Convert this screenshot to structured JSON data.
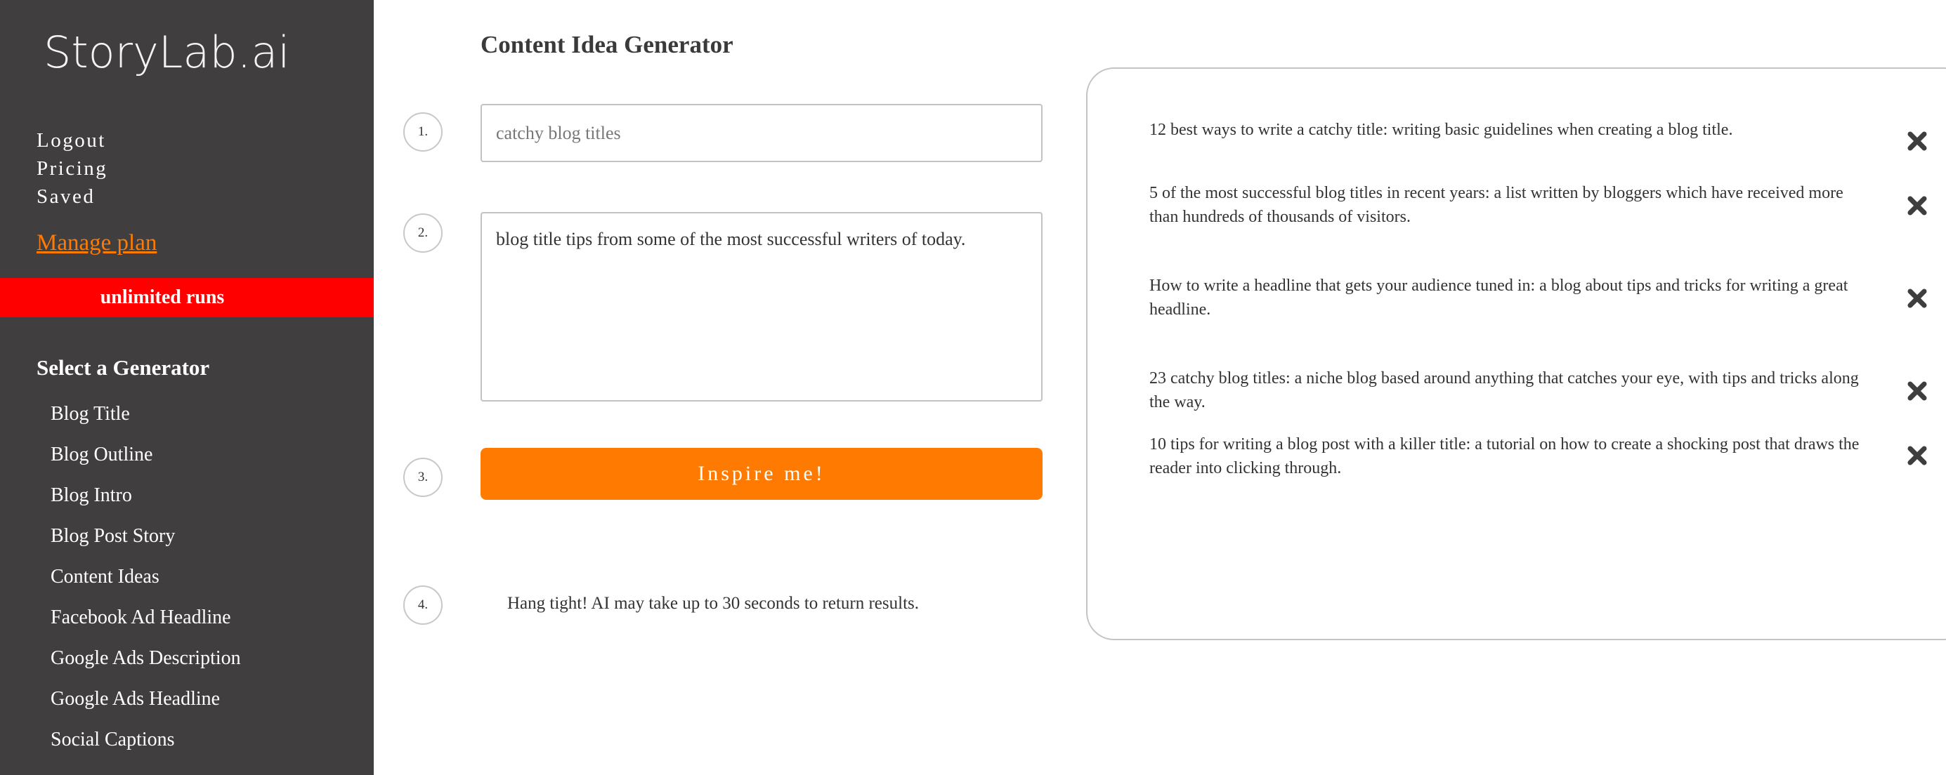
{
  "sidebar": {
    "logo": "StoryLab.ai",
    "top_links": [
      {
        "label": "Logout"
      },
      {
        "label": "Pricing"
      },
      {
        "label": "Saved"
      }
    ],
    "manage_plan": "Manage plan",
    "runs_banner": "unlimited runs",
    "generator_heading": "Select a Generator",
    "generators": [
      {
        "label": "Blog Title"
      },
      {
        "label": "Blog Outline"
      },
      {
        "label": "Blog Intro"
      },
      {
        "label": "Blog Post Story"
      },
      {
        "label": "Content Ideas"
      },
      {
        "label": "Facebook Ad Headline"
      },
      {
        "label": "Google Ads Description"
      },
      {
        "label": "Google Ads Headline"
      },
      {
        "label": "Social Captions"
      }
    ]
  },
  "main": {
    "title": "Content Idea Generator",
    "steps": [
      "1.",
      "2.",
      "3.",
      "4."
    ],
    "topic_input": {
      "value": "",
      "placeholder": "catchy blog titles"
    },
    "description_input": {
      "value": "blog title tips from some of the most successful writers of today."
    },
    "inspire_button": "Inspire me!",
    "wait_message": "Hang tight! AI may take up to 30 seconds to return results."
  },
  "results": [
    {
      "text": " 12 best ways to write a catchy title: writing basic guidelines when creating a blog title."
    },
    {
      "text": " 5 of the most successful blog titles in recent years: a list written by bloggers which have received more than hundreds of thousands of visitors."
    },
    {
      "text": " How to write a headline that gets your audience tuned in: a blog about tips and tricks for writing a great headline."
    },
    {
      "text": " 23 catchy blog titles: a niche blog based around anything that catches your eye, with tips and tricks along the way."
    },
    {
      "text": " 10 tips for writing a blog post with a killer title: a tutorial on how to create a shocking post that draws the reader into clicking through."
    }
  ],
  "colors": {
    "sidebar_bg": "#403e3f",
    "accent_orange": "#ff7a00",
    "banner_red": "#ff0000",
    "text_dark": "#333333"
  },
  "icons": {
    "remove": "close-x-icon"
  }
}
